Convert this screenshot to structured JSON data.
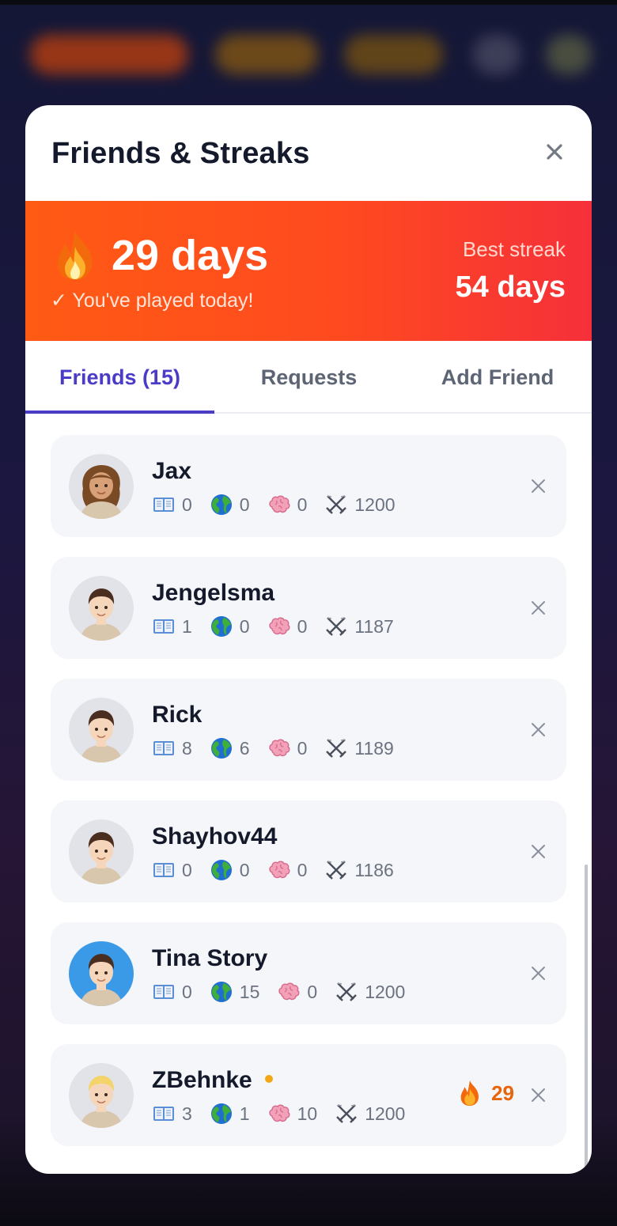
{
  "modal": {
    "title": "Friends & Streaks"
  },
  "streak": {
    "current": "29 days",
    "status": "✓ You've played today!",
    "best_label": "Best streak",
    "best_value": "54 days"
  },
  "tabs": [
    {
      "label": "Friends (15)",
      "active": true
    },
    {
      "label": "Requests",
      "active": false
    },
    {
      "label": "Add Friend",
      "active": false
    }
  ],
  "friends": [
    {
      "name": "Jax",
      "avatar": "woman-avatar",
      "books": "0",
      "globe": "0",
      "brain": "0",
      "rating": "1200"
    },
    {
      "name": "Jengelsma",
      "avatar": "man-avatar",
      "books": "1",
      "globe": "0",
      "brain": "0",
      "rating": "1187"
    },
    {
      "name": "Rick",
      "avatar": "man-avatar",
      "books": "8",
      "globe": "6",
      "brain": "0",
      "rating": "1189"
    },
    {
      "name": "Shayhov44",
      "avatar": "man-avatar",
      "books": "0",
      "globe": "0",
      "brain": "0",
      "rating": "1186"
    },
    {
      "name": "Tina Story",
      "avatar": "man-avatar-blue-bg",
      "books": "0",
      "globe": "15",
      "brain": "0",
      "rating": "1200"
    },
    {
      "name": "ZBehnke",
      "avatar": "blond-man-avatar",
      "books": "3",
      "globe": "1",
      "brain": "10",
      "rating": "1200",
      "online": true,
      "streak": "29"
    }
  ],
  "colors": {
    "accent": "#4b3cc8",
    "streak_gradient_start": "#ff5b14",
    "streak_gradient_end": "#f5303a",
    "friend_streak": "#e8650b",
    "online_dot": "#f2a814"
  }
}
